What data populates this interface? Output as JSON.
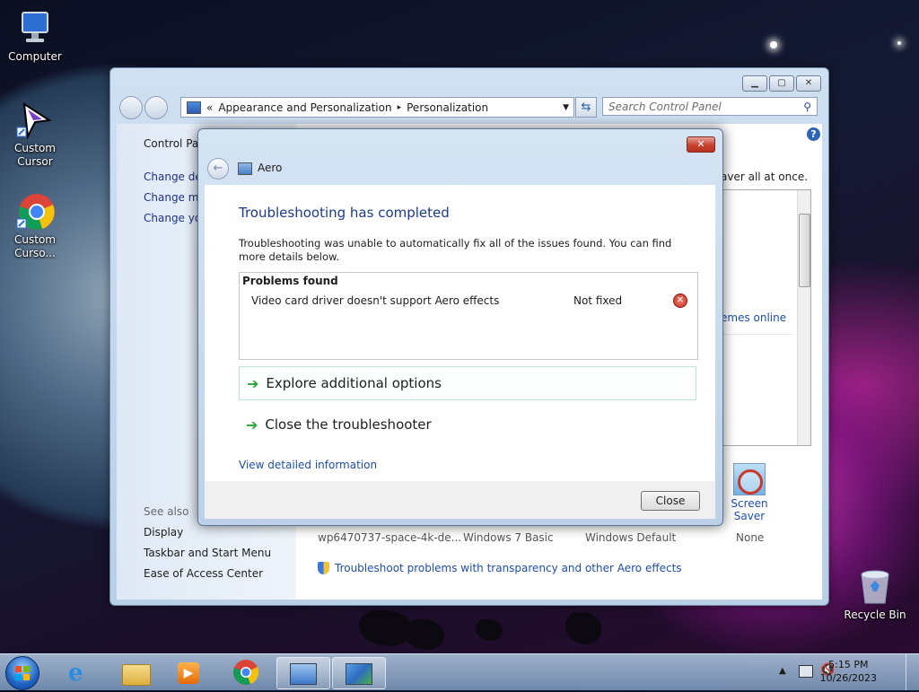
{
  "desktop": {
    "icons": [
      {
        "label": "Computer"
      },
      {
        "label": "Custom Cursor"
      },
      {
        "label": "Custom Curso..."
      },
      {
        "label": "Recycle Bin"
      }
    ]
  },
  "control_panel": {
    "breadcrumb_prefix": "«",
    "breadcrumb": [
      "Appearance and Personalization",
      "Personalization"
    ],
    "breadcrumb_sep": "▸",
    "search_placeholder": "Search Control Panel",
    "left_nav": {
      "home": "Control Pan",
      "links": [
        "Change des",
        "Change mo",
        "Change you"
      ],
      "see_also_heading": "See also",
      "see_also": [
        "Display",
        "Taskbar and Start Menu",
        "Ease of Access Center"
      ]
    },
    "desc_tail": "aver all at once.",
    "themes_online_link": "emes online",
    "bottom_labels": [
      "wp6470737-space-4k-de...",
      "Windows 7 Basic",
      "Windows Default",
      "None"
    ],
    "screen_saver_label": "Screen Saver",
    "troubleshoot_link": "Troubleshoot problems with transparency and other Aero effects"
  },
  "dialog": {
    "title": "Aero",
    "heading": "Troubleshooting has completed",
    "description": "Troubleshooting was unable to automatically fix all of the issues found. You can find more details below.",
    "problems_header": "Problems found",
    "problems": [
      {
        "name": "Video card driver doesn't support Aero effects",
        "status": "Not fixed"
      }
    ],
    "options": [
      "Explore additional options",
      "Close the troubleshooter"
    ],
    "detail_link": "View detailed information",
    "close_button": "Close"
  },
  "taskbar": {
    "time": "5:15 PM",
    "date": "10/26/2023"
  },
  "colors": {
    "link": "#1e4fa8",
    "heading": "#1d3a8a",
    "option_arrow": "#2aa336",
    "close_red": "#c8412f"
  }
}
